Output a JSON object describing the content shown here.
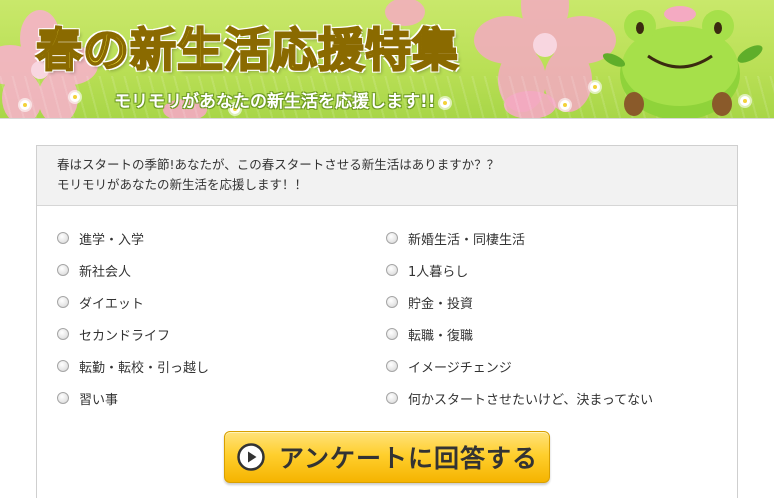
{
  "banner": {
    "title": "春の新生活応援特集",
    "subtitle": "モリモリがあなたの新生活を応援します!!"
  },
  "survey": {
    "intro_line1": "春はスタートの季節!あなたが、この春スタートさせる新生活はありますか？？",
    "intro_line2": "モリモリがあなたの新生活を応援します！！",
    "options_left": [
      "進学・入学",
      "新社会人",
      "ダイエット",
      "セカンドライフ",
      "転勤・転校・引っ越し",
      "習い事"
    ],
    "options_right": [
      "新婚生活・同棲生活",
      "1人暮らし",
      "貯金・投資",
      "転職・復職",
      "イメージチェンジ",
      "何かスタートさせたいけど、決まってない"
    ],
    "submit_label": "アンケートに回答する"
  },
  "colors": {
    "banner_green": "#b9df55",
    "title_yellow": "#fff34a",
    "button_orange": "#ffcf2e"
  },
  "icons": {
    "submit": "play-circle-icon",
    "mascot": "frog-mascot"
  }
}
